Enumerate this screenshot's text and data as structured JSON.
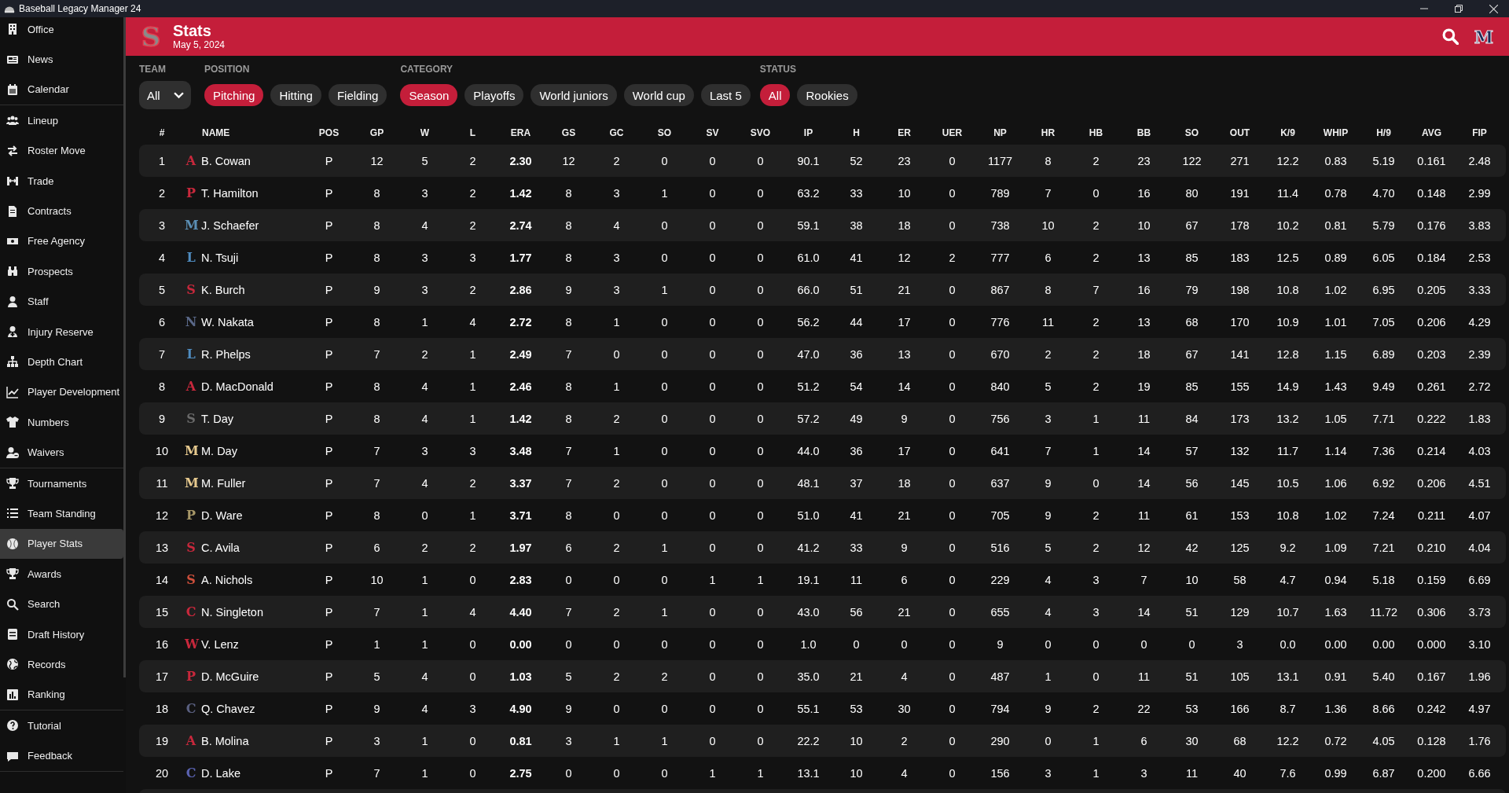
{
  "window": {
    "title": "Baseball Legacy Manager 24"
  },
  "sidebar": {
    "sections": [
      {
        "items": [
          {
            "label": "Office",
            "selected": false
          },
          {
            "label": "News",
            "selected": false
          },
          {
            "label": "Calendar",
            "selected": false
          }
        ]
      },
      {
        "items": [
          {
            "label": "Lineup",
            "selected": false
          },
          {
            "label": "Roster Move",
            "selected": false
          },
          {
            "label": "Trade",
            "selected": false
          },
          {
            "label": "Contracts",
            "selected": false
          },
          {
            "label": "Free Agency",
            "selected": false
          },
          {
            "label": "Prospects",
            "selected": false
          },
          {
            "label": "Staff",
            "selected": false
          },
          {
            "label": "Injury Reserve",
            "selected": false
          },
          {
            "label": "Depth Chart",
            "selected": false
          },
          {
            "label": "Player Development",
            "selected": false
          },
          {
            "label": "Numbers",
            "selected": false
          },
          {
            "label": "Waivers",
            "selected": false
          }
        ]
      },
      {
        "items": [
          {
            "label": "Tournaments",
            "selected": false
          },
          {
            "label": "Team Standing",
            "selected": false
          },
          {
            "label": "Player Stats",
            "selected": true
          },
          {
            "label": "Awards",
            "selected": false
          },
          {
            "label": "Search",
            "selected": false
          },
          {
            "label": "Draft History",
            "selected": false
          },
          {
            "label": "Records",
            "selected": false
          },
          {
            "label": "Ranking",
            "selected": false
          }
        ]
      },
      {
        "items": [
          {
            "label": "Tutorial",
            "selected": false
          },
          {
            "label": "Feedback",
            "selected": false
          }
        ]
      }
    ]
  },
  "header": {
    "logo": "S",
    "title": "Stats",
    "date": "May 5, 2024",
    "user_logo": "M"
  },
  "filters": {
    "team": {
      "label": "TEAM",
      "value": "All"
    },
    "groups": [
      {
        "label": "POSITION",
        "options": [
          {
            "label": "Pitching",
            "selected": true
          },
          {
            "label": "Hitting",
            "selected": false
          },
          {
            "label": "Fielding",
            "selected": false
          }
        ]
      },
      {
        "label": "CATEGORY",
        "options": [
          {
            "label": "Season",
            "selected": true
          },
          {
            "label": "Playoffs",
            "selected": false
          },
          {
            "label": "World juniors",
            "selected": false
          },
          {
            "label": "World cup",
            "selected": false
          },
          {
            "label": "Last 5",
            "selected": false
          }
        ]
      },
      {
        "label": "STATUS",
        "options": [
          {
            "label": "All",
            "selected": true
          },
          {
            "label": "Rookies",
            "selected": false
          }
        ]
      }
    ]
  },
  "table": {
    "columns": [
      {
        "label": "#",
        "kind": "rank"
      },
      {
        "label": "NAME",
        "kind": "name"
      },
      {
        "label": "POS",
        "kind": "stat"
      },
      {
        "label": "GP",
        "kind": "stat"
      },
      {
        "label": "W",
        "kind": "stat"
      },
      {
        "label": "L",
        "kind": "stat"
      },
      {
        "label": "ERA",
        "kind": "key_stat"
      },
      {
        "label": "GS",
        "kind": "stat"
      },
      {
        "label": "GC",
        "kind": "stat"
      },
      {
        "label": "SO",
        "kind": "stat"
      },
      {
        "label": "SV",
        "kind": "stat"
      },
      {
        "label": "SVO",
        "kind": "stat"
      },
      {
        "label": "IP",
        "kind": "stat"
      },
      {
        "label": "H",
        "kind": "stat"
      },
      {
        "label": "ER",
        "kind": "stat"
      },
      {
        "label": "UER",
        "kind": "stat"
      },
      {
        "label": "NP",
        "kind": "stat"
      },
      {
        "label": "HR",
        "kind": "stat"
      },
      {
        "label": "HB",
        "kind": "stat"
      },
      {
        "label": "BB",
        "kind": "stat"
      },
      {
        "label": "SO",
        "kind": "stat"
      },
      {
        "label": "OUT",
        "kind": "stat"
      },
      {
        "label": "K/9",
        "kind": "stat"
      },
      {
        "label": "WHIP",
        "kind": "stat"
      },
      {
        "label": "H/9",
        "kind": "stat"
      },
      {
        "label": "AVG",
        "kind": "stat"
      },
      {
        "label": "FIP",
        "kind": "stat"
      }
    ],
    "rows": [
      {
        "rank": "1",
        "logo": "A",
        "color": "#c8283c",
        "name": "B. Cowan",
        "stats": [
          "P",
          "12",
          "5",
          "2",
          "2.30",
          "12",
          "2",
          "0",
          "0",
          "0",
          "90.1",
          "52",
          "23",
          "0",
          "1177",
          "8",
          "2",
          "23",
          "122",
          "271",
          "12.2",
          "0.83",
          "5.19",
          "0.161",
          "2.48"
        ]
      },
      {
        "rank": "2",
        "logo": "P",
        "color": "#c8283c",
        "name": "T. Hamilton",
        "stats": [
          "P",
          "8",
          "3",
          "2",
          "1.42",
          "8",
          "3",
          "1",
          "0",
          "0",
          "63.2",
          "33",
          "10",
          "0",
          "789",
          "7",
          "0",
          "16",
          "80",
          "191",
          "11.4",
          "0.78",
          "4.70",
          "0.148",
          "2.99"
        ]
      },
      {
        "rank": "3",
        "logo": "M",
        "color": "#5b8fb5",
        "name": "J. Schaefer",
        "stats": [
          "P",
          "8",
          "4",
          "2",
          "2.74",
          "8",
          "4",
          "0",
          "0",
          "0",
          "59.1",
          "38",
          "18",
          "0",
          "738",
          "10",
          "2",
          "10",
          "67",
          "178",
          "10.2",
          "0.81",
          "5.79",
          "0.176",
          "3.83"
        ]
      },
      {
        "rank": "4",
        "logo": "L",
        "color": "#4f8cc0",
        "name": "N. Tsuji",
        "stats": [
          "P",
          "8",
          "3",
          "3",
          "1.77",
          "8",
          "3",
          "0",
          "0",
          "0",
          "61.0",
          "41",
          "12",
          "2",
          "777",
          "6",
          "2",
          "13",
          "85",
          "183",
          "12.5",
          "0.89",
          "6.05",
          "0.184",
          "2.53"
        ]
      },
      {
        "rank": "5",
        "logo": "S",
        "color": "#c8283c",
        "name": "K. Burch",
        "stats": [
          "P",
          "9",
          "3",
          "2",
          "2.86",
          "9",
          "3",
          "1",
          "0",
          "0",
          "66.0",
          "51",
          "21",
          "0",
          "867",
          "8",
          "7",
          "16",
          "79",
          "198",
          "10.8",
          "1.02",
          "6.95",
          "0.205",
          "3.33"
        ]
      },
      {
        "rank": "6",
        "logo": "N",
        "color": "#5a6888",
        "name": "W. Nakata",
        "stats": [
          "P",
          "8",
          "1",
          "4",
          "2.72",
          "8",
          "1",
          "0",
          "0",
          "0",
          "56.2",
          "44",
          "17",
          "0",
          "776",
          "11",
          "2",
          "13",
          "68",
          "170",
          "10.9",
          "1.01",
          "7.05",
          "0.206",
          "4.29"
        ]
      },
      {
        "rank": "7",
        "logo": "L",
        "color": "#4f8cc0",
        "name": "R. Phelps",
        "stats": [
          "P",
          "7",
          "2",
          "1",
          "2.49",
          "7",
          "0",
          "0",
          "0",
          "0",
          "47.0",
          "36",
          "13",
          "0",
          "670",
          "2",
          "2",
          "18",
          "67",
          "141",
          "12.8",
          "1.15",
          "6.89",
          "0.203",
          "2.39"
        ]
      },
      {
        "rank": "8",
        "logo": "A",
        "color": "#c8283c",
        "name": "D. MacDonald",
        "stats": [
          "P",
          "8",
          "4",
          "1",
          "2.46",
          "8",
          "1",
          "0",
          "0",
          "0",
          "51.2",
          "54",
          "14",
          "0",
          "840",
          "5",
          "2",
          "19",
          "85",
          "155",
          "14.9",
          "1.43",
          "9.49",
          "0.261",
          "2.72"
        ]
      },
      {
        "rank": "9",
        "logo": "S",
        "color": "#6a6a6a",
        "name": "T. Day",
        "stats": [
          "P",
          "8",
          "4",
          "1",
          "1.42",
          "8",
          "2",
          "0",
          "0",
          "0",
          "57.2",
          "49",
          "9",
          "0",
          "756",
          "3",
          "1",
          "11",
          "84",
          "173",
          "13.2",
          "1.05",
          "7.71",
          "0.222",
          "1.83"
        ]
      },
      {
        "rank": "10",
        "logo": "M",
        "color": "#e6c98e",
        "name": "M. Day",
        "stats": [
          "P",
          "7",
          "3",
          "3",
          "3.48",
          "7",
          "1",
          "0",
          "0",
          "0",
          "44.0",
          "36",
          "17",
          "0",
          "641",
          "7",
          "1",
          "14",
          "57",
          "132",
          "11.7",
          "1.14",
          "7.36",
          "0.214",
          "4.03"
        ]
      },
      {
        "rank": "11",
        "logo": "M",
        "color": "#e6c98e",
        "name": "M. Fuller",
        "stats": [
          "P",
          "7",
          "4",
          "2",
          "3.37",
          "7",
          "2",
          "0",
          "0",
          "0",
          "48.1",
          "37",
          "18",
          "0",
          "637",
          "9",
          "0",
          "14",
          "56",
          "145",
          "10.5",
          "1.06",
          "6.92",
          "0.206",
          "4.51"
        ]
      },
      {
        "rank": "12",
        "logo": "P",
        "color": "#a89868",
        "name": "D. Ware",
        "stats": [
          "P",
          "8",
          "0",
          "1",
          "3.71",
          "8",
          "0",
          "0",
          "0",
          "0",
          "51.0",
          "41",
          "21",
          "0",
          "705",
          "9",
          "2",
          "11",
          "61",
          "153",
          "10.8",
          "1.02",
          "7.24",
          "0.211",
          "4.07"
        ]
      },
      {
        "rank": "13",
        "logo": "S",
        "color": "#c8283c",
        "name": "C. Avila",
        "stats": [
          "P",
          "6",
          "2",
          "2",
          "1.97",
          "6",
          "2",
          "1",
          "0",
          "0",
          "41.2",
          "33",
          "9",
          "0",
          "516",
          "5",
          "2",
          "12",
          "42",
          "125",
          "9.2",
          "1.09",
          "7.21",
          "0.210",
          "4.04"
        ]
      },
      {
        "rank": "14",
        "logo": "S",
        "color": "#d0503c",
        "name": "A. Nichols",
        "stats": [
          "P",
          "10",
          "1",
          "0",
          "2.83",
          "0",
          "0",
          "0",
          "1",
          "1",
          "19.1",
          "11",
          "6",
          "0",
          "229",
          "4",
          "3",
          "7",
          "10",
          "58",
          "4.7",
          "0.94",
          "5.18",
          "0.159",
          "6.69"
        ]
      },
      {
        "rank": "15",
        "logo": "C",
        "color": "#c8283c",
        "name": "N. Singleton",
        "stats": [
          "P",
          "7",
          "1",
          "4",
          "4.40",
          "7",
          "2",
          "1",
          "0",
          "0",
          "43.0",
          "56",
          "21",
          "0",
          "655",
          "4",
          "3",
          "14",
          "51",
          "129",
          "10.7",
          "1.63",
          "11.72",
          "0.306",
          "3.73"
        ]
      },
      {
        "rank": "16",
        "logo": "W",
        "color": "#c8283c",
        "name": "V. Lenz",
        "stats": [
          "P",
          "1",
          "1",
          "0",
          "0.00",
          "0",
          "0",
          "0",
          "0",
          "0",
          "1.0",
          "0",
          "0",
          "0",
          "9",
          "0",
          "0",
          "0",
          "0",
          "3",
          "0.0",
          "0.00",
          "0.00",
          "0.000",
          "3.10"
        ]
      },
      {
        "rank": "17",
        "logo": "P",
        "color": "#c8283c",
        "name": "D. McGuire",
        "stats": [
          "P",
          "5",
          "4",
          "0",
          "1.03",
          "5",
          "2",
          "2",
          "0",
          "0",
          "35.0",
          "21",
          "4",
          "0",
          "487",
          "1",
          "0",
          "11",
          "51",
          "105",
          "13.1",
          "0.91",
          "5.40",
          "0.167",
          "1.96"
        ]
      },
      {
        "rank": "18",
        "logo": "C",
        "color": "#5a6080",
        "name": "Q. Chavez",
        "stats": [
          "P",
          "9",
          "4",
          "3",
          "4.90",
          "9",
          "0",
          "0",
          "0",
          "0",
          "55.1",
          "53",
          "30",
          "0",
          "794",
          "9",
          "2",
          "22",
          "53",
          "166",
          "8.7",
          "1.36",
          "8.66",
          "0.242",
          "4.97"
        ]
      },
      {
        "rank": "19",
        "logo": "A",
        "color": "#c8283c",
        "name": "B. Molina",
        "stats": [
          "P",
          "3",
          "1",
          "0",
          "0.81",
          "3",
          "1",
          "1",
          "0",
          "0",
          "22.2",
          "10",
          "2",
          "0",
          "290",
          "0",
          "1",
          "6",
          "30",
          "68",
          "12.2",
          "0.72",
          "4.05",
          "0.128",
          "1.76"
        ]
      },
      {
        "rank": "20",
        "logo": "C",
        "color": "#5a62b0",
        "name": "D. Lake",
        "stats": [
          "P",
          "7",
          "1",
          "0",
          "2.75",
          "0",
          "0",
          "0",
          "1",
          "1",
          "13.1",
          "10",
          "4",
          "0",
          "156",
          "3",
          "1",
          "3",
          "11",
          "40",
          "7.6",
          "0.99",
          "6.87",
          "0.200",
          "6.66"
        ]
      }
    ]
  }
}
